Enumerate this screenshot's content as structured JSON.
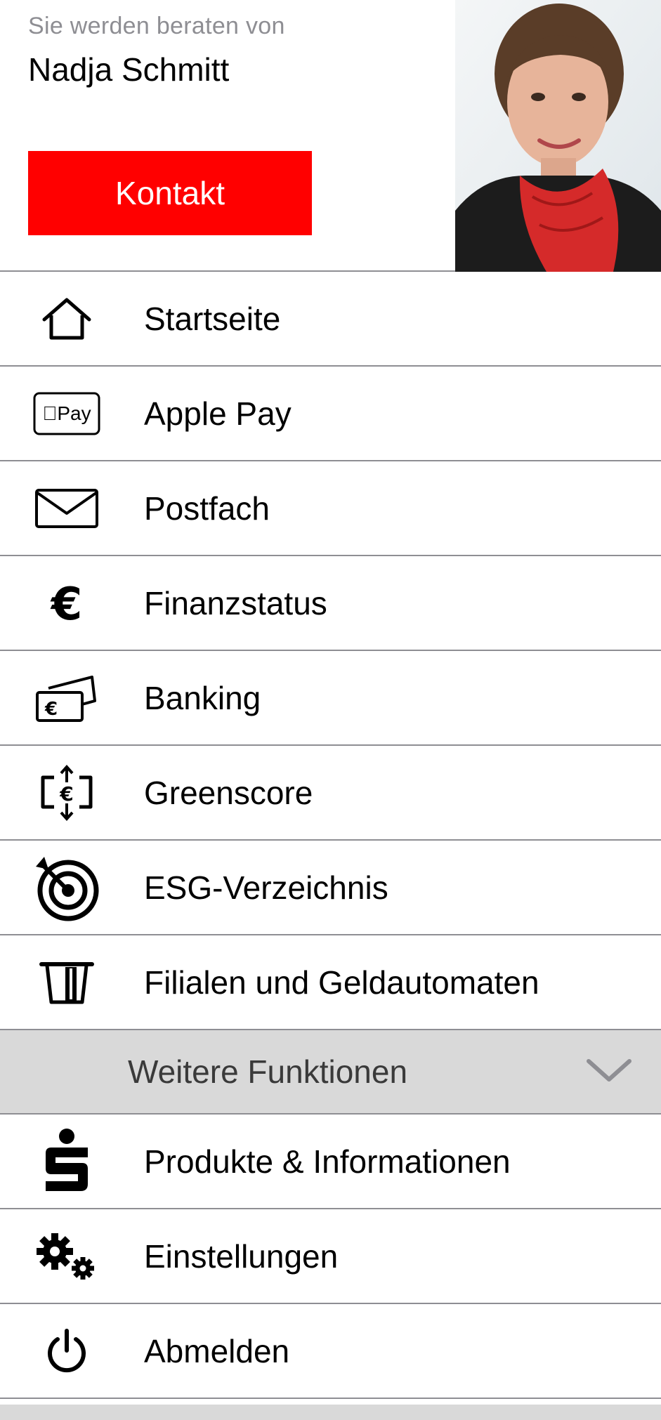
{
  "advisor": {
    "caption": "Sie werden beraten von",
    "name": "Nadja Schmitt",
    "contact_label": "Kontakt"
  },
  "menu": {
    "items": [
      {
        "label": "Startseite",
        "icon": "home-icon"
      },
      {
        "label": "Apple Pay",
        "icon": "apple-pay-icon",
        "icon_text": "Pay"
      },
      {
        "label": "Postfach",
        "icon": "envelope-icon"
      },
      {
        "label": "Finanzstatus",
        "icon": "euro-icon",
        "icon_text": "€"
      },
      {
        "label": "Banking",
        "icon": "banknotes-icon"
      },
      {
        "label": "Greenscore",
        "icon": "euro-transfer-icon"
      },
      {
        "label": "ESG-Verzeichnis",
        "icon": "target-icon"
      },
      {
        "label": "Filialen und Geldautomaten",
        "icon": "atm-icon"
      }
    ],
    "more": {
      "label": "Weitere Funktionen",
      "icon": "chevron-down-icon"
    },
    "extra_items": [
      {
        "label": "Produkte & Informationen",
        "icon": "sparkasse-logo-icon"
      },
      {
        "label": "Einstellungen",
        "icon": "gears-icon"
      },
      {
        "label": "Abmelden",
        "icon": "power-icon"
      }
    ]
  },
  "colors": {
    "accent": "#ff0000",
    "caption": "#8e8e93",
    "divider": "#8e8e93",
    "more_bar": "#d9d9d9"
  }
}
